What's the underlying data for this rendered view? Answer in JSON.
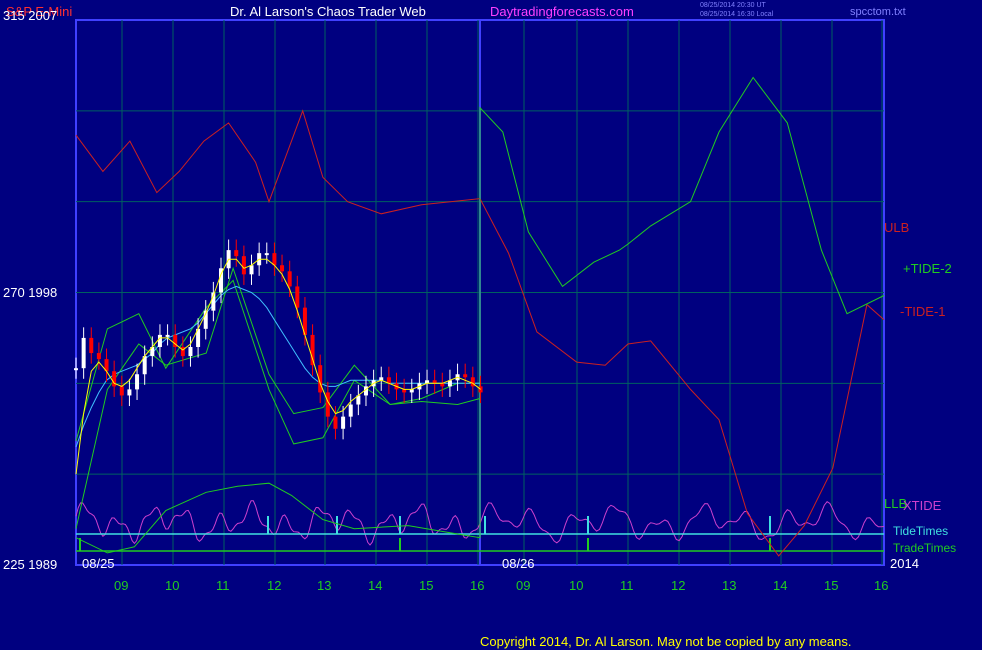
{
  "header": {
    "instrument": "S&P E-Mini",
    "title": "Dr. Al Larson's Chaos Trader Web",
    "site": "Daytradingforecasts.com",
    "ut_stamp": "08/25/2014 20:30 UT",
    "local_stamp": "08/25/2014 16:30 Local",
    "file": "spcctom.txt"
  },
  "y_labels": {
    "top": "315  2007",
    "mid": "270  1998",
    "bottom": "225  1989"
  },
  "copyright": "Copyright 2014, Dr. Al Larson. May not be copied by any means.",
  "colors": {
    "background": "#000080",
    "frame": "#4040ff",
    "grid": "#006060",
    "divider": "#4040ff",
    "ulb": "#cc2020",
    "llb": "#20cc20",
    "xtide": "#cc40cc",
    "tide_times": "#40e0e0",
    "trade_times": "#20cc20",
    "up_bar": "#ffffff",
    "down_bar": "#ff0000",
    "ma_fast": "#ffff00",
    "ma_slow": "#40c0ff",
    "time_label": "#20cc20",
    "label_white": "#ffffff"
  },
  "chart_data": {
    "type": "line",
    "title": "S&P E-Mini",
    "y_axis": {
      "labels": [
        "315  2007",
        "270  1998",
        "225  1989"
      ],
      "price_range": [
        1989,
        2007
      ],
      "raw_range": [
        225,
        315
      ]
    },
    "x_axis": {
      "day_labels": [
        "08/25",
        "08/26"
      ],
      "hour_ticks": [
        "09",
        "10",
        "11",
        "12",
        "13",
        "14",
        "15",
        "16",
        "09",
        "10",
        "11",
        "12",
        "13",
        "14",
        "15",
        "16"
      ],
      "year": "2014"
    },
    "grid": true,
    "series_labels": {
      "ulb": "ULB",
      "tide2": "+TIDE-2",
      "tide1": "-TIDE-1",
      "llb": "LLB",
      "xtide": "XTIDE",
      "tide_times": "TideTimes",
      "trade_times": "TradeTimes"
    },
    "price_close": [
      1995.5,
      1996.5,
      1996.0,
      1995.8,
      1995.4,
      1994.9,
      1994.6,
      1994.8,
      1995.3,
      1995.9,
      1996.2,
      1996.6,
      1996.6,
      1996.2,
      1995.9,
      1996.2,
      1996.8,
      1997.4,
      1998.0,
      1998.8,
      1999.4,
      1999.2,
      1998.6,
      1998.9,
      1999.3,
      1999.3,
      1998.9,
      1998.7,
      1998.2,
      1997.5,
      1996.6,
      1995.6,
      1994.7,
      1993.9,
      1993.5,
      1993.9,
      1994.3,
      1994.6,
      1994.9,
      1995.1,
      1995.2,
      1995.0,
      1994.8,
      1994.7,
      1994.8,
      1995.0,
      1995.1,
      1995.0,
      1994.9,
      1995.1,
      1995.3,
      1995.2,
      1994.9,
      1994.7
    ],
    "price_ohlc_notes": "53 bars from 08/25 08:30 to 16:00, alternating up/down per close",
    "ma_fast": [
      1992.0,
      1994.0,
      1995.4,
      1995.7,
      1995.4,
      1995.0,
      1994.9,
      1995.1,
      1995.5,
      1995.9,
      1996.2,
      1996.5,
      1996.5,
      1996.3,
      1996.1,
      1996.3,
      1996.8,
      1997.3,
      1997.9,
      1998.6,
      1999.1,
      1999.1,
      1998.8,
      1998.9,
      1999.1,
      1999.1,
      1998.9,
      1998.6,
      1998.1,
      1997.4,
      1996.6,
      1995.8,
      1995.0,
      1994.4,
      1994.0,
      1994.1,
      1994.4,
      1994.6,
      1994.8,
      1995.0,
      1995.1,
      1995.0,
      1994.9,
      1994.8,
      1994.8,
      1994.9,
      1995.0,
      1995.0,
      1995.0,
      1995.1,
      1995.2,
      1995.1,
      1995.0,
      1994.8
    ],
    "ma_slow": [
      1992.9,
      1993.6,
      1994.2,
      1994.7,
      1995.1,
      1995.3,
      1995.4,
      1995.5,
      1995.6,
      1995.8,
      1996.0,
      1996.3,
      1996.5,
      1996.6,
      1996.7,
      1996.8,
      1997.0,
      1997.3,
      1997.6,
      1997.9,
      1998.1,
      1998.2,
      1998.1,
      1998.0,
      1997.8,
      1997.5,
      1997.1,
      1996.7,
      1996.3,
      1995.9,
      1995.5,
      1995.2,
      1995.0,
      1994.9,
      1994.9,
      1995.0,
      1995.1,
      1995.1,
      1995.1,
      1995.1,
      1995.1,
      1995.0,
      1995.0,
      1995.0,
      1995.0,
      1995.0,
      1995.0,
      1995.0,
      1995.0,
      1995.0,
      1995.0,
      1995.0,
      1995.0,
      1995.0
    ],
    "ulb": [
      [
        0,
        2003.2
      ],
      [
        12,
        2002.0
      ],
      [
        24,
        2003.0
      ],
      [
        36,
        2001.3
      ],
      [
        46,
        2002.0
      ],
      [
        57,
        2003.0
      ],
      [
        68,
        2003.6
      ],
      [
        80,
        2002.3
      ],
      [
        86,
        2001.0
      ],
      [
        94,
        2002.6
      ],
      [
        101,
        2004.0
      ],
      [
        110,
        2001.8
      ],
      [
        121,
        2001.0
      ],
      [
        136,
        2000.6
      ],
      [
        154,
        2000.9
      ],
      [
        180,
        2001.1
      ],
      [
        180,
        2001.1
      ],
      [
        190,
        1999.3
      ],
      [
        200,
        1996.7
      ],
      [
        214,
        1995.7
      ],
      [
        224,
        1995.6
      ],
      [
        232,
        1996.3
      ],
      [
        240,
        1996.4
      ],
      [
        254,
        1994.8
      ],
      [
        264,
        1993.8
      ],
      [
        274,
        1990.7
      ],
      [
        285,
        1989.3
      ],
      [
        294,
        1990.3
      ],
      [
        304,
        1992.2
      ],
      [
        316,
        1997.6
      ],
      [
        322,
        1997.1
      ]
    ],
    "llb": [
      [
        0,
        1989.9
      ],
      [
        14,
        1989.4
      ],
      [
        26,
        1989.6
      ],
      [
        40,
        1990.8
      ],
      [
        58,
        1991.4
      ],
      [
        72,
        1991.6
      ],
      [
        86,
        1991.7
      ],
      [
        96,
        1991.3
      ],
      [
        110,
        1990.5
      ],
      [
        124,
        1990.2
      ],
      [
        148,
        1990.3
      ],
      [
        172,
        1990.0
      ],
      [
        180,
        1989.9
      ],
      [
        180,
        2004.1
      ],
      [
        188,
        2003.3
      ],
      [
        197,
        2000.0
      ],
      [
        209,
        1998.2
      ],
      [
        220,
        1999.0
      ],
      [
        229,
        1999.4
      ],
      [
        232,
        1999.6
      ],
      [
        240,
        2000.2
      ],
      [
        254,
        2001.0
      ],
      [
        264,
        2003.3
      ],
      [
        276,
        2005.1
      ],
      [
        288,
        2003.6
      ],
      [
        300,
        1999.4
      ],
      [
        309,
        1997.3
      ],
      [
        322,
        1997.9
      ]
    ],
    "tide1": [
      [
        0,
        1990.2
      ],
      [
        14,
        1994.8
      ],
      [
        28,
        1996.3
      ],
      [
        40,
        1995.6
      ],
      [
        58,
        1996.0
      ],
      [
        70,
        1998.8
      ],
      [
        86,
        1995.3
      ],
      [
        97,
        1994.0
      ],
      [
        110,
        1994.2
      ],
      [
        124,
        1995.6
      ],
      [
        140,
        1994.3
      ],
      [
        154,
        1994.4
      ],
      [
        170,
        1994.3
      ],
      [
        180,
        1994.5
      ]
    ],
    "tide2": [
      [
        0,
        1993.1
      ],
      [
        14,
        1996.8
      ],
      [
        28,
        1997.3
      ],
      [
        40,
        1995.5
      ],
      [
        58,
        1997.5
      ],
      [
        70,
        1998.4
      ],
      [
        86,
        1994.8
      ],
      [
        97,
        1993.0
      ],
      [
        110,
        1993.2
      ],
      [
        124,
        1995.1
      ],
      [
        140,
        1994.3
      ],
      [
        154,
        1994.5
      ],
      [
        170,
        1995.0
      ],
      [
        180,
        1995.0
      ]
    ],
    "xtide": [
      [
        0,
        1990.5
      ],
      [
        8,
        1990.6
      ],
      [
        14,
        1989.4
      ],
      [
        30,
        1990.1
      ],
      [
        48,
        1990.3
      ],
      [
        70,
        1991.2
      ],
      [
        90,
        1990.4
      ],
      [
        110,
        1990.7
      ],
      [
        140,
        1990.2
      ],
      [
        160,
        1990.4
      ],
      [
        180,
        1990.2
      ],
      [
        190,
        1990.4
      ],
      [
        200,
        1989.6
      ],
      [
        220,
        1990.2
      ],
      [
        240,
        1990.6
      ],
      [
        260,
        1990.3
      ],
      [
        280,
        1990.0
      ],
      [
        300,
        1991.2
      ],
      [
        322,
        1990.7
      ]
    ]
  }
}
